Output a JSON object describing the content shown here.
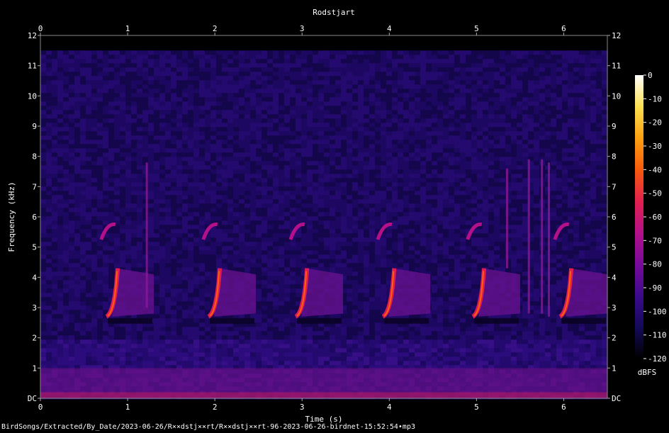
{
  "chart_data": {
    "type": "heatmap",
    "title": "Rodstjart",
    "xlabel": "Time (s)",
    "ylabel": "Frequency (kHz)",
    "xlim": [
      0,
      6.5
    ],
    "ylim": [
      0,
      12
    ],
    "x_ticks": [
      {
        "value": 0,
        "label": "0"
      },
      {
        "value": 1,
        "label": "1"
      },
      {
        "value": 2,
        "label": "2"
      },
      {
        "value": 3,
        "label": "3"
      },
      {
        "value": 4,
        "label": "4"
      },
      {
        "value": 5,
        "label": "5"
      },
      {
        "value": 6,
        "label": "6"
      }
    ],
    "y_ticks": [
      {
        "value": 0,
        "label": "DC"
      },
      {
        "value": 1,
        "label": "1"
      },
      {
        "value": 2,
        "label": "2"
      },
      {
        "value": 3,
        "label": "3"
      },
      {
        "value": 4,
        "label": "4"
      },
      {
        "value": 5,
        "label": "5"
      },
      {
        "value": 6,
        "label": "6"
      },
      {
        "value": 7,
        "label": "7"
      },
      {
        "value": 8,
        "label": "8"
      },
      {
        "value": 9,
        "label": "9"
      },
      {
        "value": 10,
        "label": "10"
      },
      {
        "value": 11,
        "label": "11"
      },
      {
        "value": 12,
        "label": "12"
      }
    ],
    "colorbar": {
      "unit": "dBFS",
      "range": [
        -120,
        0
      ],
      "ticks": [
        "0",
        "-10",
        "-20",
        "-30",
        "-40",
        "-50",
        "-60",
        "-70",
        "-80",
        "-90",
        "-100",
        "-110",
        "-120"
      ],
      "colors": [
        "#000000",
        "#140a5a",
        "#3c0a8c",
        "#780a9a",
        "#b4108a",
        "#e2204e",
        "#f85a0c",
        "#fca010",
        "#fce050",
        "#ffffff"
      ]
    },
    "background_color": "#240a6e",
    "max_frequency_recorded_khz": 11.5,
    "call_onsets_s": [
      0.75,
      1.92,
      2.92,
      3.92,
      4.95,
      5.95
    ],
    "call_bands_khz": [
      [
        2.7,
        4.3
      ],
      [
        5.2,
        5.8
      ]
    ],
    "grid": false
  },
  "footer": {
    "path": "BirdSongs/Extracted/By_Date/2023-06-26/R××dstj××rt/R××dstj××rt-96-2023-06-26-birdnet-15:52:54•mp3"
  }
}
